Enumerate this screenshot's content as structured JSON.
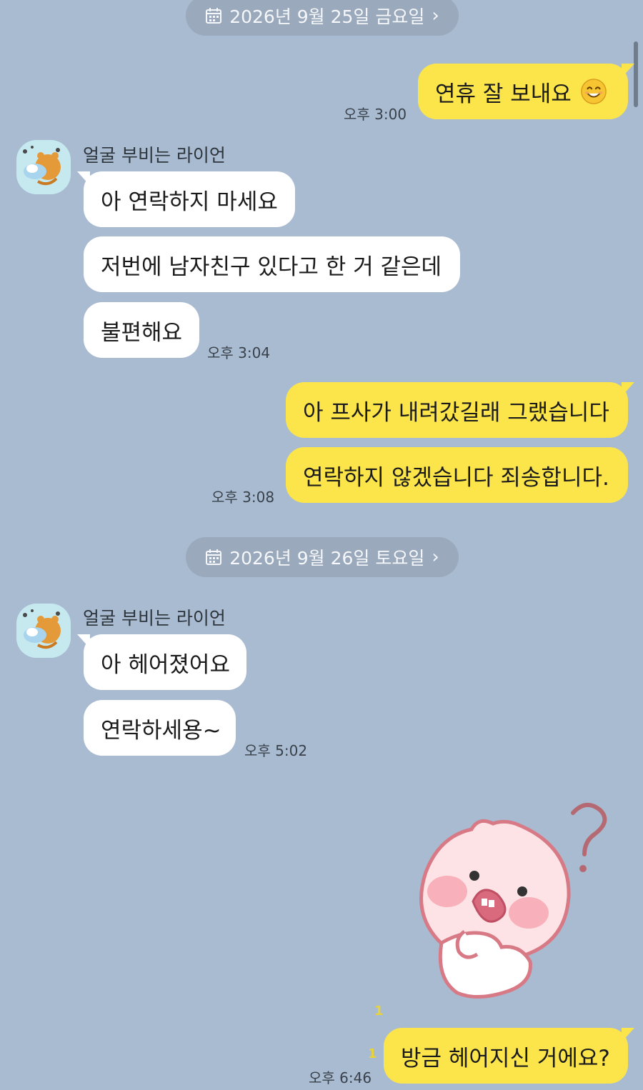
{
  "dates": [
    "2026년 9월 25일 금요일",
    "2026년 9월 26일 토요일"
  ],
  "sender": "얼굴 부비는 라이언",
  "icons": {
    "calendar": "calendar-icon",
    "chevron": "chevron-right-icon",
    "emoji": "smiling-face-icon",
    "avatar": "ryan-character",
    "sticker": "apeach-question-sticker"
  },
  "colors": {
    "background": "#a9bbd1",
    "incoming_bubble": "#ffffff",
    "outgoing_bubble": "#fbe54a",
    "date_pill": "#9aa9bb"
  },
  "messages": {
    "m1": "연휴 잘 보내요",
    "m2": "아 연락하지 마세요",
    "m3": "저번에 남자친구 있다고 한 거 같은데",
    "m4": "불편해요",
    "m5": "아 프사가 내려갔길래 그랬습니다",
    "m6": "연락하지 않겠습니다 죄송합니다.",
    "m7": "아 헤어졌어요",
    "m8": "연락하세용~",
    "m9": "방금 헤어지신 거에요?"
  },
  "times": {
    "t1": "오후 3:00",
    "t2": "오후 3:04",
    "t3": "오후 3:08",
    "t4": "오후 5:02",
    "t5": "오후 6:46"
  },
  "unread_count": "1"
}
